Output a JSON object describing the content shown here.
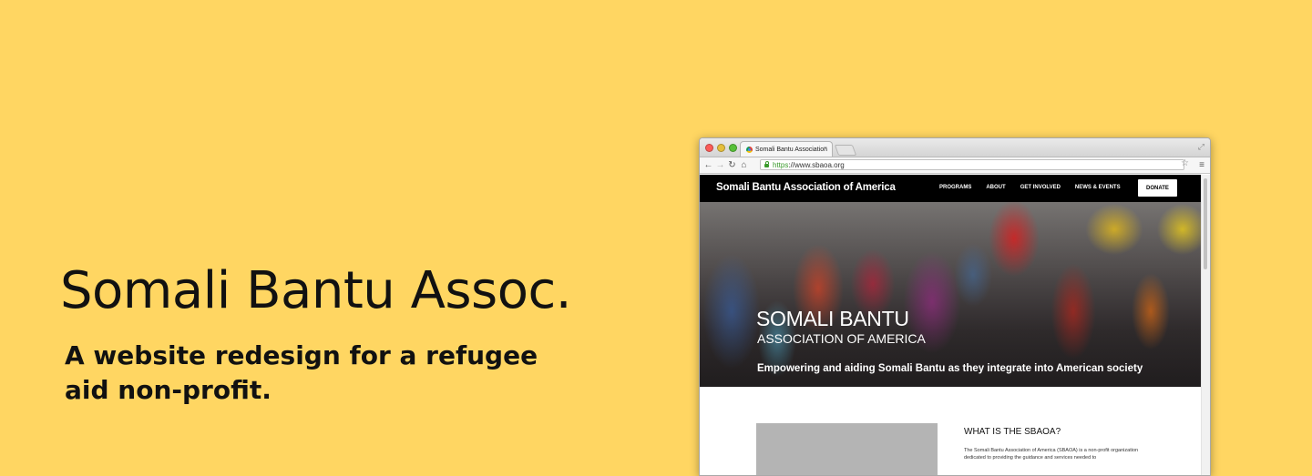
{
  "hero": {
    "title": "Somali Bantu Assoc.",
    "subtitle": "A website redesign for a refugee aid non-profit."
  },
  "browser": {
    "tab_title": "Somali Bantu Association",
    "tab_close": "×",
    "url_scheme": "https",
    "url_rest": "://www.sbaoa.org"
  },
  "site": {
    "brand": "Somali Bantu Association of America",
    "nav": [
      "PROGRAMS",
      "ABOUT",
      "GET INVOLVED",
      "NEWS & EVENTS"
    ],
    "donate": "DONATE",
    "banner": {
      "title": "SOMALI BANTU",
      "subtitle": "ASSOCIATION OF AMERICA",
      "tagline": "Empowering and aiding Somali Bantu as they integrate into American society"
    },
    "about": {
      "heading": "WHAT IS THE SBAOA?",
      "body": "The Somali Bantu Association of America (SBAOA) is a non-profit organization dedicated to providing the guidance and services needed to"
    }
  },
  "colors": {
    "background": "#FFD662",
    "site_nav": "#000000",
    "url_secure": "#3a9a2c"
  }
}
